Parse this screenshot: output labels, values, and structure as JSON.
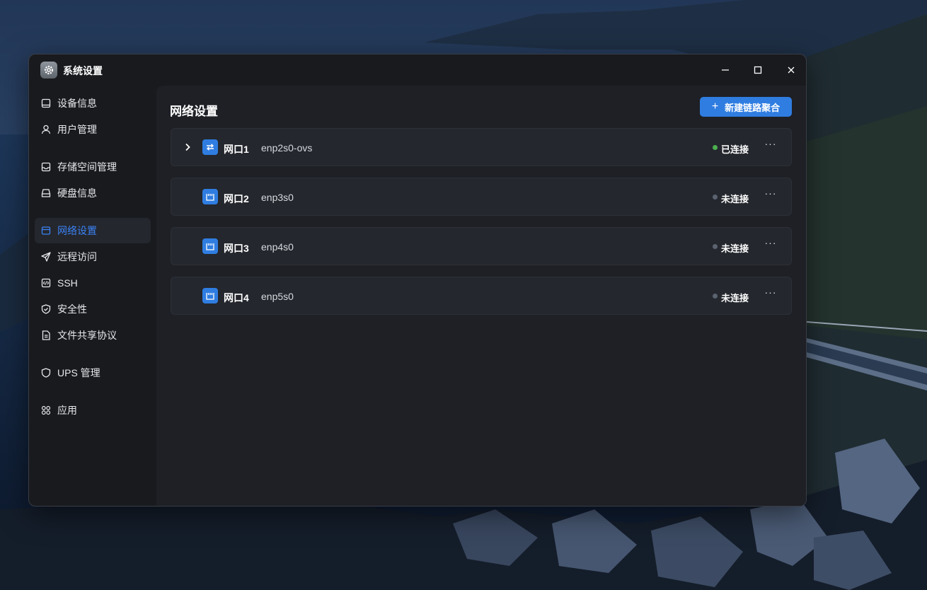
{
  "window": {
    "title": "系统设置",
    "icon": "gear-icon"
  },
  "sidebar": {
    "items": [
      {
        "label": "设备信息",
        "icon": "monitor-icon"
      },
      {
        "label": "用户管理",
        "icon": "user-icon"
      },
      {
        "label": "存储空间管理",
        "icon": "inbox-icon"
      },
      {
        "label": "硬盘信息",
        "icon": "disk-icon"
      },
      {
        "label": "网络设置",
        "icon": "network-window-icon",
        "active": true
      },
      {
        "label": "远程访问",
        "icon": "send-icon"
      },
      {
        "label": "SSH",
        "icon": "code-icon"
      },
      {
        "label": "安全性",
        "icon": "shield-check-icon"
      },
      {
        "label": "文件共享协议",
        "icon": "document-icon"
      },
      {
        "label": "UPS 管理",
        "icon": "shield-icon"
      },
      {
        "label": "应用",
        "icon": "apps-grid-icon"
      }
    ]
  },
  "main": {
    "title": "网络设置",
    "new_button": {
      "plus": "+",
      "label": "新建链路聚合"
    },
    "ports": [
      {
        "name": "网口1",
        "iface": "enp2s0-ovs",
        "status": "已连接",
        "connected": true,
        "expandable": true,
        "icon": "bridge-icon"
      },
      {
        "name": "网口2",
        "iface": "enp3s0",
        "status": "未连接",
        "connected": false,
        "expandable": false,
        "icon": "ethernet-port-icon"
      },
      {
        "name": "网口3",
        "iface": "enp4s0",
        "status": "未连接",
        "connected": false,
        "expandable": false,
        "icon": "ethernet-port-icon"
      },
      {
        "name": "网口4",
        "iface": "enp5s0",
        "status": "未连接",
        "connected": false,
        "expandable": false,
        "icon": "ethernet-port-icon"
      }
    ],
    "more_label": "···"
  },
  "colors": {
    "accent": "#2f7de1",
    "connected": "#4caf50",
    "disconnected": "#5b6270"
  }
}
